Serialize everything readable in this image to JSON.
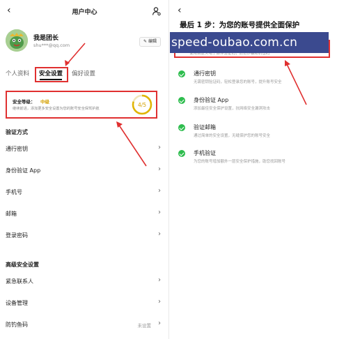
{
  "left": {
    "nav": {
      "back": "‹",
      "title": "用户中心"
    },
    "profile": {
      "name": "我是团长",
      "email": "shu***@qq.com",
      "edit_label": "编辑"
    },
    "tabs": [
      "个人资料",
      "安全设置",
      "偏好设置"
    ],
    "security": {
      "label": "安全等级：",
      "level": "中级",
      "description": "继续前进，添加更多安全设置为您的账号安全保驾护航",
      "score": "4/5"
    },
    "verification": {
      "title": "验证方式",
      "items": [
        {
          "label": "通行密钥",
          "value": ""
        },
        {
          "label": "身份验证 App",
          "value": ""
        },
        {
          "label": "手机号",
          "value": ""
        },
        {
          "label": "邮箱",
          "value": ""
        },
        {
          "label": "登录密码",
          "value": ""
        }
      ]
    },
    "advanced": {
      "title": "高级安全设置",
      "items": [
        {
          "label": "紧急联系人",
          "value": ""
        },
        {
          "label": "设备管理",
          "value": ""
        },
        {
          "label": "防钓鱼码",
          "value": "未设置"
        }
      ]
    }
  },
  "right": {
    "back": "‹",
    "title": "最后 1 步：为您的账号提供全面保护",
    "watermark": "speed-oubao.com.cn",
    "highlight_sub": "使用自定义电子邮件验证码，防范诈骗和钓鱼码",
    "items": [
      {
        "title": "通行密钥",
        "desc": "无需密钥验证码，轻松登录您的账号，提升账号安全"
      },
      {
        "title": "身份验证 App",
        "desc": "添加最佳安全保护设置，抗网络安全漏洞攻击"
      },
      {
        "title": "验证邮箱",
        "desc": "通过简单的安全设置，无缝保护您的账号安全"
      },
      {
        "title": "手机验证",
        "desc": "为您的账号增加额外一层安全保护措施，助您找回账号"
      }
    ]
  },
  "colors": {
    "annotation_red": "#e03030",
    "check_green": "#2ebd4e",
    "level_yellow": "#d4a000",
    "watermark_blue": "#3b4a8f"
  },
  "icons": {
    "settings": "user-settings-icon",
    "edit": "edit-icon",
    "chevron": "chevron-right-icon",
    "check": "check-circle-icon"
  }
}
